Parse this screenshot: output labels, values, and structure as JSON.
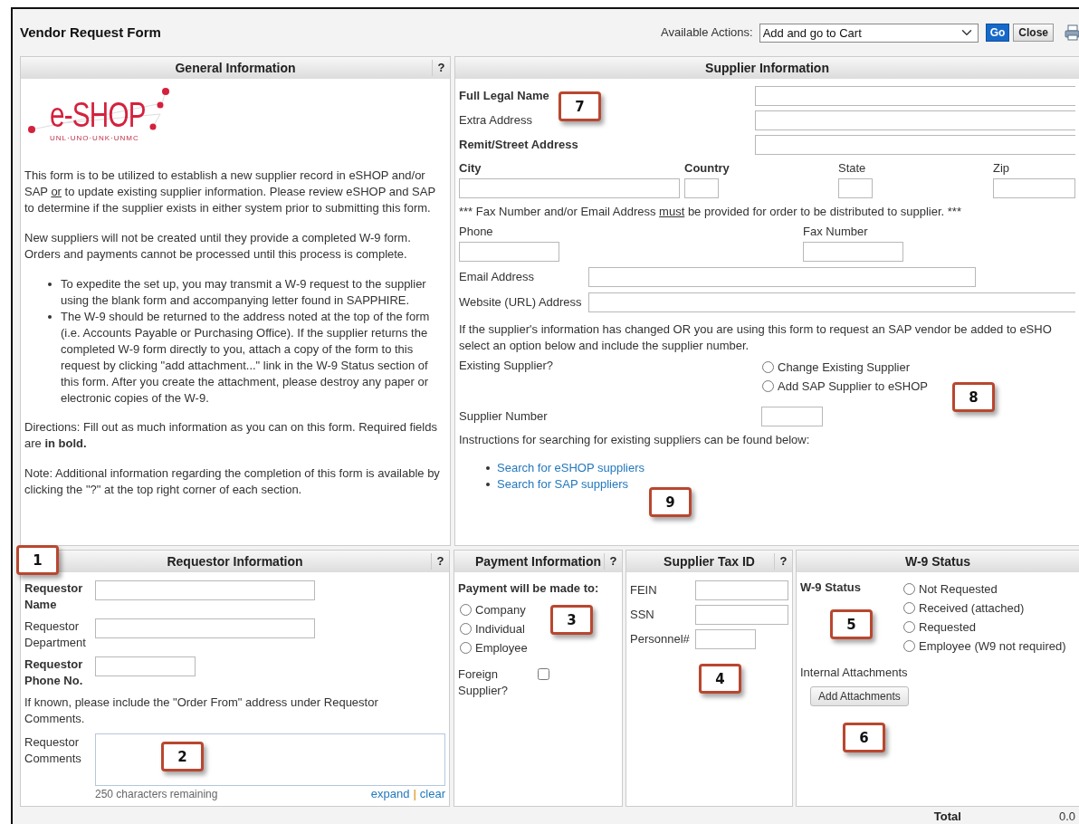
{
  "window": {
    "title": "Vendor Request Form"
  },
  "actions": {
    "label": "Available Actions:",
    "value": "Add and go to Cart",
    "buttons": [
      {
        "label": "Go",
        "kind": "primary"
      },
      {
        "label": "Close",
        "kind": "secondary"
      }
    ]
  },
  "general": {
    "title": "General Information",
    "help": "?",
    "logo": {
      "wordmark": "e-SHOP",
      "tagline": "UNL·UNO·UNK·UNMC"
    },
    "intro": [
      {
        "text": "This form is to be utilized to establish a new supplier record in eSHOP and/or SAP ",
        "underline": false
      },
      {
        "text": "or",
        "underline": true
      },
      {
        "text": " to update existing supplier information. Please review eSHOP and SAP to determine if the supplier exists in either system prior to submitting this form.",
        "underline": false
      }
    ],
    "paragraph": "New suppliers will not be created until they provide a completed W-9 form. Orders and payments cannot be processed until this process is complete.",
    "bullets": [
      "To expedite the set up, you may transmit a W-9 request to the supplier using the blank form and accompanying letter found in SAPPHIRE.",
      "The W-9 should be returned to the address noted at the top of the form (i.e. Accounts Payable or Purchasing Office). If the supplier returns the completed W-9 form directly to you, attach a copy of the form to this request by clicking \"add attachment...\" link in the W-9 Status section of this form. After you create the attachment, please destroy any paper or electronic copies of the W-9."
    ],
    "directions": "Directions: Fill out as much information as you can on this form. Required fields are **in bold.**",
    "note": "Note: Additional information regarding the completion of this form is available by clicking the \"?\" at the top right corner of each section."
  },
  "supplier": {
    "title": "Supplier Information",
    "callout": "7",
    "name_fields": [
      {
        "label": "Full Legal Name",
        "required": true
      },
      {
        "label": "Extra Address",
        "required": false
      },
      {
        "label": "Remit/Street Address",
        "required": true
      }
    ],
    "location_fields": [
      {
        "label": "City",
        "required": true
      },
      {
        "label": "Country",
        "required": true
      },
      {
        "label": "State",
        "required": false
      },
      {
        "label": "Zip",
        "required": false
      }
    ],
    "fax_note": [
      {
        "text": "*** Fax Number and/or Email Address ",
        "underline": false
      },
      {
        "text": "must",
        "underline": true
      },
      {
        "text": " be provided for order to be distributed to supplier. ***",
        "underline": false
      }
    ],
    "contact_fields": [
      {
        "label": "Phone",
        "required": false
      },
      {
        "label": "Fax Number",
        "required": false
      }
    ],
    "web_fields": [
      {
        "label": "Email Address",
        "required": false
      },
      {
        "label": "Website (URL) Address",
        "required": false
      }
    ],
    "change_note": [
      "If the supplier's information has changed OR you are using this form to request an SAP vendor be added to eSHO",
      "select an option below and include the supplier number."
    ],
    "existing": {
      "label": "Existing Supplier?",
      "options": [
        {
          "label": "Change Existing Supplier",
          "selected": false
        },
        {
          "label": "Add SAP Supplier to eSHOP",
          "selected": false
        }
      ],
      "callout": "8"
    },
    "supplier_number": {
      "label": "Supplier Number"
    },
    "search_note": "Instructions for searching for existing suppliers can be found below:",
    "links": [
      "Search for eSHOP suppliers",
      "Search for SAP suppliers"
    ],
    "links_callout": "9"
  },
  "requestor": {
    "title": "Requestor Information",
    "help": "?",
    "callout": "1",
    "fields": [
      {
        "label": "Requestor Name",
        "required": true
      },
      {
        "label": "Requestor Department",
        "required": false
      },
      {
        "label": "Requestor Phone No.",
        "required": true
      }
    ],
    "note": "If known, please include the \"Order From\" address under Requestor Comments.",
    "comments": {
      "label": "Requestor Comments",
      "callout": "2",
      "remaining": "250 characters remaining",
      "links": [
        "expand",
        "clear"
      ],
      "separator": "|"
    }
  },
  "payment": {
    "title": "Payment Information",
    "help": "?",
    "label": "Payment will be made to:",
    "callout": "3",
    "options": [
      {
        "label": "Company",
        "selected": false
      },
      {
        "label": "Individual",
        "selected": false
      },
      {
        "label": "Employee",
        "selected": false
      }
    ],
    "foreign": {
      "label": "Foreign Supplier?",
      "checked": false
    }
  },
  "tax": {
    "title": "Supplier Tax ID",
    "help": "?",
    "callout": "4",
    "fields": [
      {
        "label": "FEIN"
      },
      {
        "label": "SSN"
      },
      {
        "label": "Personnel#"
      }
    ]
  },
  "w9": {
    "title": "W-9 Status",
    "label": "W-9 Status",
    "callout": "5",
    "options": [
      {
        "label": "Not Requested",
        "selected": false
      },
      {
        "label": "Received (attached)",
        "selected": false
      },
      {
        "label": "Requested",
        "selected": false
      },
      {
        "label": "Employee (W9 not required)",
        "selected": false
      }
    ],
    "attachments_label": "Internal Attachments",
    "button": "Add Attachments",
    "button_callout": "6"
  },
  "total": {
    "label": "Total",
    "value": "0.0"
  }
}
